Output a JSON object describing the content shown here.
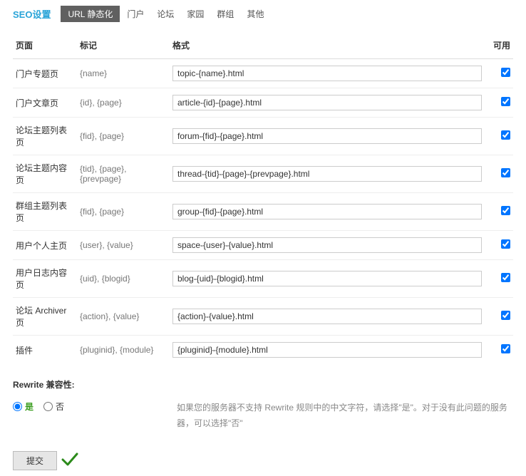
{
  "header": {
    "title": "SEO设置",
    "tabs": [
      "URL 静态化",
      "门户",
      "论坛",
      "家园",
      "群组",
      "其他"
    ],
    "active_tab": 0
  },
  "table": {
    "headers": {
      "page": "页面",
      "tag": "标记",
      "format": "格式",
      "available": "可用"
    },
    "rows": [
      {
        "page": "门户专题页",
        "tag": "{name}",
        "format": "topic-{name}.html",
        "checked": true
      },
      {
        "page": "门户文章页",
        "tag": "{id}, {page}",
        "format": "article-{id}-{page}.html",
        "checked": true
      },
      {
        "page": "论坛主题列表页",
        "tag": "{fid}, {page}",
        "format": "forum-{fid}-{page}.html",
        "checked": true
      },
      {
        "page": "论坛主题内容页",
        "tag": "{tid}, {page}, {prevpage}",
        "format": "thread-{tid}-{page}-{prevpage}.html",
        "checked": true
      },
      {
        "page": "群组主题列表页",
        "tag": "{fid}, {page}",
        "format": "group-{fid}-{page}.html",
        "checked": true
      },
      {
        "page": "用户个人主页",
        "tag": "{user}, {value}",
        "format": "space-{user}-{value}.html",
        "checked": true
      },
      {
        "page": "用户日志内容页",
        "tag": "{uid}, {blogid}",
        "format": "blog-{uid}-{blogid}.html",
        "checked": true
      },
      {
        "page": "论坛 Archiver 页",
        "tag": "{action}, {value}",
        "format": "{action}-{value}.html",
        "checked": true
      },
      {
        "page": "插件",
        "tag": "{pluginid}, {module}",
        "format": "{pluginid}-{module}.html",
        "checked": true
      }
    ]
  },
  "rewrite": {
    "label": "Rewrite 兼容性:",
    "yes": "是",
    "no": "否",
    "selected": "yes",
    "hint": "如果您的服务器不支持 Rewrite 规则中的中文字符，请选择\"是\"。对于没有此问题的服务器，可以选择\"否\""
  },
  "submit": {
    "label": "提交"
  }
}
